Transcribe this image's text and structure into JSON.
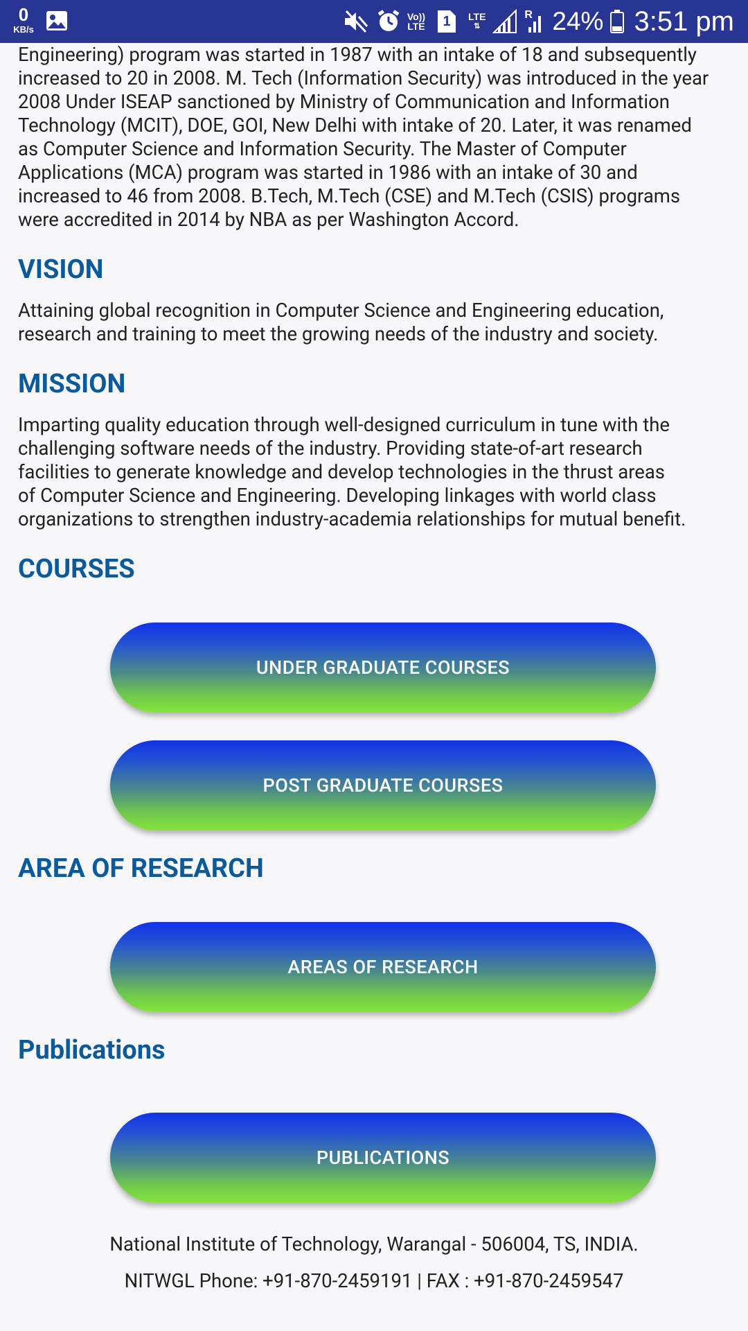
{
  "status_bar": {
    "net_speed_value": "0",
    "net_speed_unit": "KB/s",
    "volte_top": "Vo))",
    "volte_bottom": "LTE",
    "sim_number": "1",
    "lte_label": "LTE",
    "roaming_label": "R",
    "battery_percent": "24%",
    "time": "3:51 pm",
    "icons": [
      "gallery-icon",
      "mute-icon",
      "alarm-icon",
      "volte-icon",
      "sim-icon",
      "lte-icon",
      "signal-icon",
      "roaming-signal-icon",
      "battery-icon"
    ]
  },
  "intro": {
    "lines": [
      "Engineering) program was started in 1987 with an intake of 18 and subsequently",
      "increased to 20 in 2008. M. Tech (Information Security) was introduced in the year",
      "2008 Under ISEAP sanctioned by Ministry of Communication and Information",
      "Technology (MCIT), DOE, GOI, New Delhi with intake of 20. Later, it was renamed",
      "as Computer Science and Information Security. The Master of Computer",
      "Applications (MCA) program was started in 1986 with an intake of 30 and",
      "increased to 46 from 2008. B.Tech, M.Tech (CSE) and M.Tech (CSIS) programs",
      "were accredited in 2014 by NBA as per Washington Accord."
    ]
  },
  "vision": {
    "heading": "VISION",
    "lines": [
      "Attaining global recognition in Computer Science and Engineering education,",
      "research and training to meet the growing needs of the industry and society."
    ]
  },
  "mission": {
    "heading": "MISSION",
    "lines": [
      "Imparting quality education through well-designed curriculum in tune with the",
      "challenging software needs of the industry.  Providing state-of-art research",
      "facilities to generate knowledge and develop technologies in the thrust areas",
      "of Computer Science and Engineering.  Developing linkages with world class",
      "organizations to strengthen industry-academia relationships for mutual benefit."
    ]
  },
  "courses": {
    "heading": "COURSES",
    "ug_button": "UNDER GRADUATE COURSES",
    "pg_button": "POST GRADUATE COURSES"
  },
  "research": {
    "heading": "AREA OF RESEARCH",
    "button": "AREAS OF RESEARCH"
  },
  "publications": {
    "heading": "Publications",
    "button": "PUBLICATIONS"
  },
  "footer": {
    "address": "National Institute of Technology, Warangal - 506004, TS, INDIA.",
    "contact": "NITWGL Phone: +91-870-2459191 | FAX : +91-870-2459547"
  },
  "colors": {
    "status_bar": "#283593",
    "heading": "#0b5a9c",
    "button_top": "#1232e8",
    "button_bottom": "#84e33a"
  }
}
